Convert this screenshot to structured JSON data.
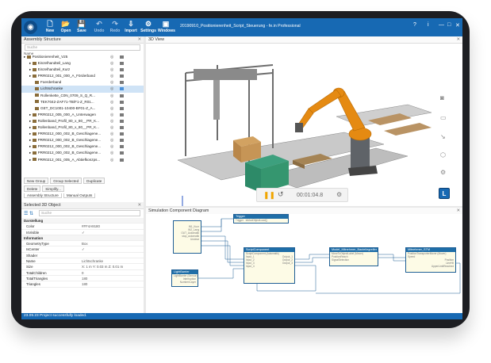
{
  "app": {
    "title": "20190910_Positionierenheit_Script_Steuerung - fe.in Professional",
    "toolbar": [
      {
        "label": "New",
        "icon": "new-file-icon",
        "enabled": true
      },
      {
        "label": "Open",
        "icon": "folder-open-icon",
        "enabled": true
      },
      {
        "label": "Save",
        "icon": "save-icon",
        "enabled": true
      },
      {
        "label": "Undo",
        "icon": "undo-icon",
        "enabled": false
      },
      {
        "label": "Redo",
        "icon": "redo-icon",
        "enabled": false
      },
      {
        "label": "Import",
        "icon": "import-icon",
        "enabled": true
      },
      {
        "label": "Settings",
        "icon": "gear-icon",
        "enabled": true
      },
      {
        "label": "Windows",
        "icon": "windows-icon",
        "enabled": true
      }
    ],
    "accent": "#1769b3"
  },
  "assembly": {
    "header": "Assembly Structure",
    "search_placeholder": "Suche",
    "column_name": "Name",
    "items": [
      {
        "label": "Positionierenheit_V25",
        "indent": 0,
        "selected": false
      },
      {
        "label": "Einzelhandteil_Lang",
        "indent": 1,
        "selected": false
      },
      {
        "label": "Einzelhandteil_Kurz",
        "indent": 1,
        "selected": false
      },
      {
        "label": "PRR0212_001_000_A_Förderband",
        "indent": 1,
        "selected": false
      },
      {
        "label": "Foerderband",
        "indent": 2,
        "selected": false
      },
      {
        "label": "Lichtschranke",
        "indent": 2,
        "selected": true
      },
      {
        "label": "Rollenkette_C0N_0709_S_Q_R...",
        "indent": 2,
        "selected": false
      },
      {
        "label": "TEK7042-ZAF71-TB/F1-Z_R01...",
        "indent": 2,
        "selected": false
      },
      {
        "label": "GET_DC1001-10400-BF01-Z_A...",
        "indent": 2,
        "selected": false
      },
      {
        "label": "PRR0212_005_000_A_Unterwagen",
        "indent": 1,
        "selected": false
      },
      {
        "label": "Rollenband_Profil_80_x_80__PR_K...",
        "indent": 1,
        "selected": false
      },
      {
        "label": "Rollenband_Profil_80_x_80__PR_K...",
        "indent": 1,
        "selected": false
      },
      {
        "label": "PRR0212_000_002_B_Geschlagene...",
        "indent": 1,
        "selected": false
      },
      {
        "label": "PRR0212_000_002_B_Geschlagene...",
        "indent": 1,
        "selected": false
      },
      {
        "label": "PRR0212_000_002_B_Geschlagene...",
        "indent": 1,
        "selected": false
      },
      {
        "label": "PRR0212_000_002_B_Geschlagene...",
        "indent": 1,
        "selected": false
      },
      {
        "label": "PRR0212_001_005_A_Abtiefkonzps...",
        "indent": 1,
        "selected": false
      }
    ],
    "buttons": [
      "New Group",
      "Group Selected",
      "Duplicate",
      "Delete",
      "Simplify..."
    ],
    "tabs": [
      "Assembly Structure",
      "Manual Outputs"
    ]
  },
  "selected_object": {
    "header": "Selected 3D Object",
    "search_placeholder": "Suche",
    "rows": [
      {
        "key": "Darstellung",
        "value": "",
        "category": true
      },
      {
        "key": "Color",
        "value": "#FF4A9180",
        "category": false
      },
      {
        "key": "IsVisible",
        "value": "✓",
        "category": false
      },
      {
        "key": "Information",
        "value": "",
        "category": true
      },
      {
        "key": "GeometryType",
        "value": "Box",
        "category": false
      },
      {
        "key": "IsCenter",
        "value": "✓",
        "category": false
      },
      {
        "key": "Shader",
        "value": "",
        "category": false
      },
      {
        "key": "Name",
        "value": "Lichtschranke",
        "category": false
      },
      {
        "key": "Size",
        "value": "X: 1 m Y: 0.03 m Z: 0.01 m",
        "category": false
      },
      {
        "key": "TotalChildren",
        "value": "0",
        "category": false
      },
      {
        "key": "TotalTriangles",
        "value": "180",
        "category": false
      },
      {
        "key": "Triangles",
        "value": "180",
        "category": false
      }
    ]
  },
  "view3d": {
    "header": "3D View",
    "time": "00:01:04.8",
    "side_icons": [
      "camera-icon",
      "dimension-icon",
      "measure-icon",
      "cube-icon",
      "robot-icon"
    ]
  },
  "diagram": {
    "header": "Simulation Component Diagram",
    "boxes": [
      {
        "title": "SignalsIn",
        "sub": "",
        "lines": [
          "IN1_Kurz",
          "IN2_Lang",
          "OUT_Automatik",
          "stop_automatik",
          "Unclear"
        ]
      },
      {
        "title": "LightBarrier",
        "sub": "LightBarrier (Sensor)",
        "lines": [
          "Interruption",
          "Number/Layer"
        ]
      },
      {
        "title": "Trigger",
        "sub": "",
        "lines": [
          "Trigger",
          "IsModObjectLoad()"
        ]
      },
      {
        "title": "ScriptComponent",
        "sub": "ScriptComponent (Automatik)",
        "lines": [
          "Input_1",
          "Input_2",
          "Input_3",
          "Input_4",
          "Output_1",
          "Output_2",
          "Output_3"
        ]
      },
      {
        "title": "Model_Mitnehmer_Bauteilegreifer",
        "sub": "MoveToObjectLabel (Mover)",
        "lines": [
          "PositionReach",
          "SignalSelection"
        ]
      },
      {
        "title": "Mitnehmer_STM",
        "sub": "PositionTransporterMover (Mover)",
        "lines": [
          "Speed",
          "Position",
          "LineHit",
          "UpperLimitReached"
        ]
      }
    ]
  },
  "status": {
    "text": "23.09.23 Project successfully loaded."
  }
}
